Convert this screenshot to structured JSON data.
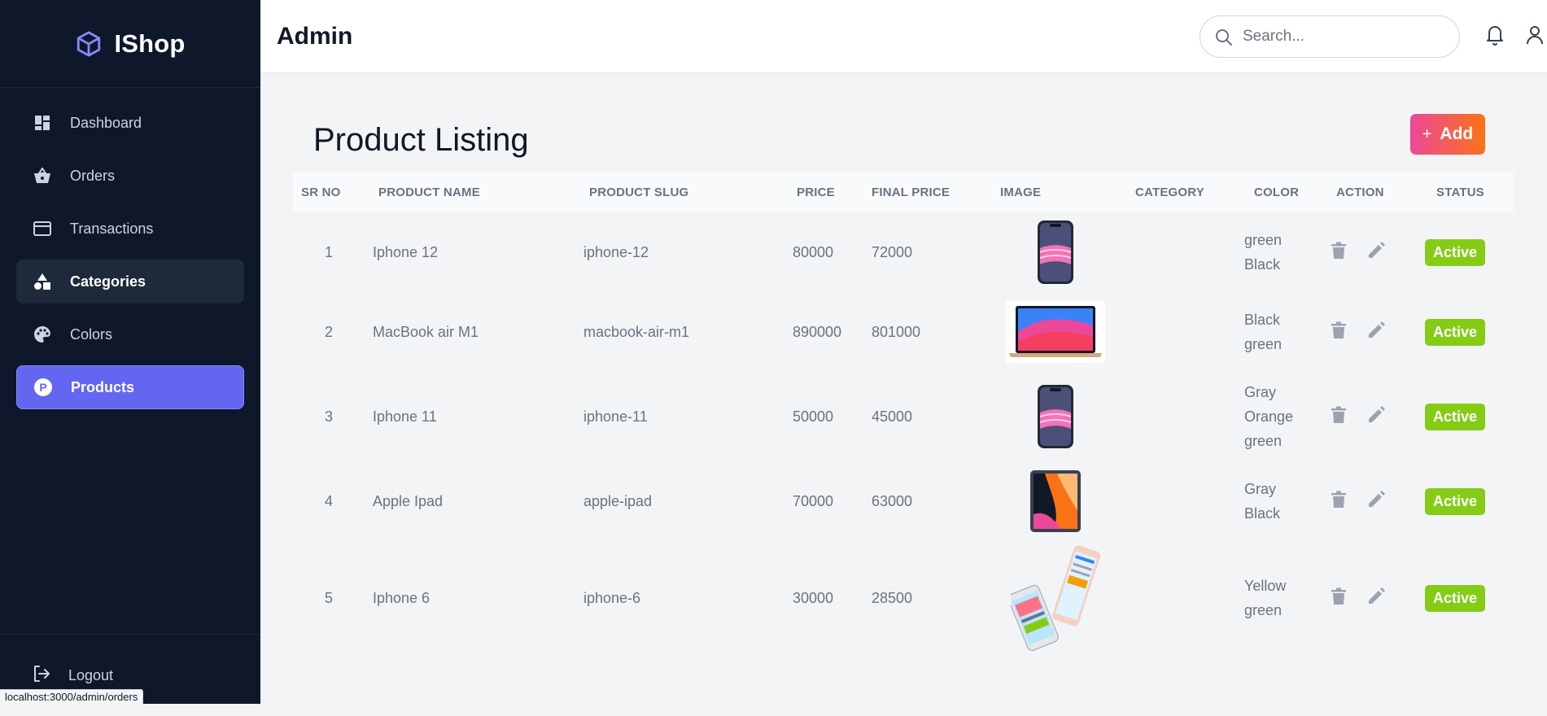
{
  "brand": {
    "name": "IShop"
  },
  "sidebar": {
    "items": [
      {
        "label": "Dashboard",
        "icon": "dashboard-icon"
      },
      {
        "label": "Orders",
        "icon": "basket-icon"
      },
      {
        "label": "Transactions",
        "icon": "card-icon"
      },
      {
        "label": "Categories",
        "icon": "shapes-icon"
      },
      {
        "label": "Colors",
        "icon": "palette-icon"
      },
      {
        "label": "Products",
        "icon": "product-p-icon"
      }
    ],
    "logout": {
      "label": "Logout",
      "icon": "logout-icon"
    }
  },
  "header": {
    "title": "Admin",
    "search": {
      "placeholder": "Search...",
      "value": ""
    }
  },
  "main": {
    "title": "Product Listing",
    "add_label": "Add",
    "table": {
      "headers": [
        "SR NO",
        "PRODUCT NAME",
        "PRODUCT SLUG",
        "PRICE",
        "FINAL PRICE",
        "IMAGE",
        "CATEGORY",
        "COLOR",
        "ACTION",
        "STATUS"
      ],
      "rows": [
        {
          "sr": "1",
          "name": "Iphone 12",
          "slug": "iphone-12",
          "price": "80000",
          "final": "72000",
          "image": "iphone",
          "category": "",
          "colors": [
            "green",
            "Black"
          ],
          "status": "Active"
        },
        {
          "sr": "2",
          "name": "MacBook air M1",
          "slug": "macbook-air-m1",
          "price": "890000",
          "final": "801000",
          "image": "macbook",
          "category": "",
          "colors": [
            "Black",
            "green"
          ],
          "status": "Active"
        },
        {
          "sr": "3",
          "name": "Iphone 11",
          "slug": "iphone-11",
          "price": "50000",
          "final": "45000",
          "image": "iphone",
          "category": "",
          "colors": [
            "Gray",
            "Orange",
            "green"
          ],
          "status": "Active"
        },
        {
          "sr": "4",
          "name": "Apple Ipad",
          "slug": "apple-ipad",
          "price": "70000",
          "final": "63000",
          "image": "ipad",
          "category": "",
          "colors": [
            "Gray",
            "Black"
          ],
          "status": "Active"
        },
        {
          "sr": "5",
          "name": "Iphone 6",
          "slug": "iphone-6",
          "price": "30000",
          "final": "28500",
          "image": "iphone6",
          "category": "",
          "colors": [
            "Yellow",
            "green"
          ],
          "status": "Active"
        }
      ]
    }
  },
  "statusbar": {
    "url": "localhost:3000/admin/orders"
  },
  "colors": {
    "sidebar_bg": "#0f172a",
    "accent": "#6366f1",
    "active_badge": "#84cc16",
    "add_gradient_from": "#ec4899",
    "add_gradient_to": "#f97316"
  }
}
